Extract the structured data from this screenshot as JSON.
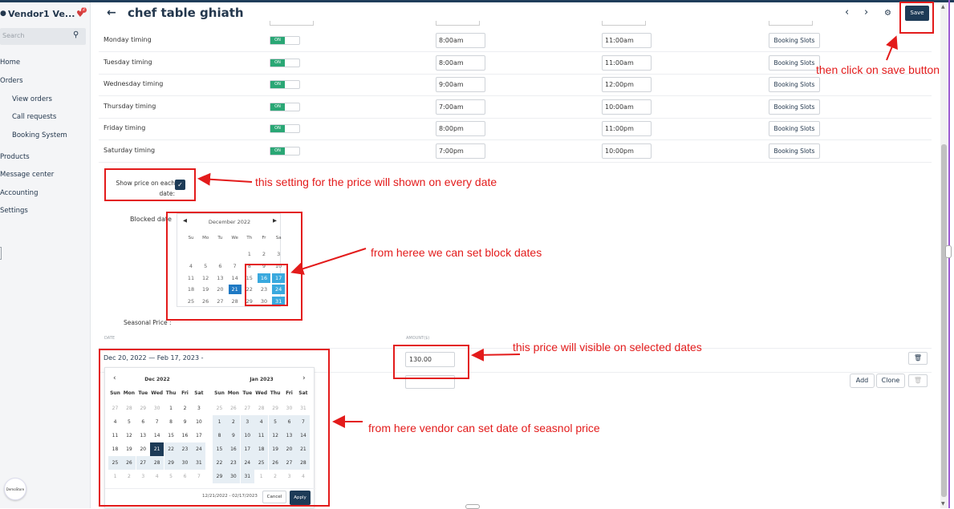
{
  "sidebar": {
    "vendor_name": "Vendor1 Ve...",
    "notification_count": "2",
    "search_placeholder": "Search",
    "nav": [
      {
        "label": "Home",
        "sub": false
      },
      {
        "label": "Orders",
        "sub": false
      },
      {
        "label": "View orders",
        "sub": true
      },
      {
        "label": "Call requests",
        "sub": true
      },
      {
        "label": "Booking System",
        "sub": true
      },
      {
        "label": "Products",
        "sub": false
      },
      {
        "label": "Message center",
        "sub": false
      },
      {
        "label": "Accounting",
        "sub": false
      },
      {
        "label": "Settings",
        "sub": false
      }
    ],
    "logo_text": "DemoStore"
  },
  "header": {
    "title": "chef table ghiath",
    "save_label": "Save"
  },
  "timings": [
    {
      "day": "Monday timing",
      "toggle": "ON",
      "start": "8:00am",
      "end": "11:00am",
      "slots": "Booking Slots"
    },
    {
      "day": "Tuesday timing",
      "toggle": "ON",
      "start": "8:00am",
      "end": "11:00am",
      "slots": "Booking Slots"
    },
    {
      "day": "Wednesday timing",
      "toggle": "ON",
      "start": "9:00am",
      "end": "12:00pm",
      "slots": "Booking Slots"
    },
    {
      "day": "Thursday timing",
      "toggle": "ON",
      "start": "7:00am",
      "end": "10:00am",
      "slots": "Booking Slots"
    },
    {
      "day": "Friday timing",
      "toggle": "ON",
      "start": "8:00pm",
      "end": "11:00pm",
      "slots": "Booking Slots"
    },
    {
      "day": "Saturday timing",
      "toggle": "ON",
      "start": "7:00pm",
      "end": "10:00pm",
      "slots": "Booking Slots"
    }
  ],
  "show_price": {
    "label": "Show price on each date:",
    "checked": true
  },
  "blocked": {
    "label": "Blocked date",
    "month": "December 2022",
    "dow": [
      "Su",
      "Mo",
      "Tu",
      "We",
      "Th",
      "Fr",
      "Sa"
    ],
    "weeks": [
      [
        "",
        "",
        "",
        "",
        "1",
        "2",
        "3"
      ],
      [
        "4",
        "5",
        "6",
        "7",
        "8",
        "9",
        "10"
      ],
      [
        "11",
        "12",
        "13",
        "14",
        "15",
        "16",
        "17"
      ],
      [
        "18",
        "19",
        "20",
        "21",
        "22",
        "23",
        "24"
      ],
      [
        "25",
        "26",
        "27",
        "28",
        "29",
        "30",
        "31"
      ]
    ],
    "selected": [
      "16",
      "17",
      "24",
      "31"
    ],
    "today": "21"
  },
  "seasonal": {
    "label": "Seasonal Price :",
    "col_date": "DATE",
    "col_amount": "AMOUNT($)",
    "range": "Dec 20, 2022 — Feb 17, 2023 -",
    "amount": "130.00",
    "add_label": "Add",
    "clone_label": "Clone"
  },
  "range_picker": {
    "dow": [
      "Sun",
      "Mon",
      "Tue",
      "Wed",
      "Thu",
      "Fri",
      "Sat"
    ],
    "left_month": "Dec 2022",
    "right_month": "Jan 2023",
    "left_weeks": [
      [
        "27",
        "28",
        "29",
        "30",
        "1",
        "2",
        "3"
      ],
      [
        "4",
        "5",
        "6",
        "7",
        "8",
        "9",
        "10"
      ],
      [
        "11",
        "12",
        "13",
        "14",
        "15",
        "16",
        "17"
      ],
      [
        "18",
        "19",
        "20",
        "21",
        "22",
        "23",
        "24"
      ],
      [
        "25",
        "26",
        "27",
        "28",
        "29",
        "30",
        "31"
      ],
      [
        "1",
        "2",
        "3",
        "4",
        "5",
        "6",
        "7"
      ]
    ],
    "right_weeks": [
      [
        "25",
        "26",
        "27",
        "28",
        "29",
        "30",
        "31"
      ],
      [
        "1",
        "2",
        "3",
        "4",
        "5",
        "6",
        "7"
      ],
      [
        "8",
        "9",
        "10",
        "11",
        "12",
        "13",
        "14"
      ],
      [
        "15",
        "16",
        "17",
        "18",
        "19",
        "20",
        "21"
      ],
      [
        "22",
        "23",
        "24",
        "25",
        "26",
        "27",
        "28"
      ],
      [
        "29",
        "30",
        "31",
        "1",
        "2",
        "3",
        "4"
      ]
    ],
    "range_text": "12/21/2022 - 02/17/2023",
    "cancel_label": "Cancel",
    "apply_label": "Apply"
  },
  "annotations": {
    "save": "then click on save button",
    "price": "this setting for the price will shown on every date",
    "block": "from heree we can set block dates",
    "amount": "this price will visible on selected dates",
    "season": "from here vendor can set date of seasnol price"
  },
  "colors": {
    "accent": "#1d3b57",
    "toggle_on": "#2aa775",
    "blocked_selected": "#3aa9de",
    "annotation": "#e31b1b"
  }
}
